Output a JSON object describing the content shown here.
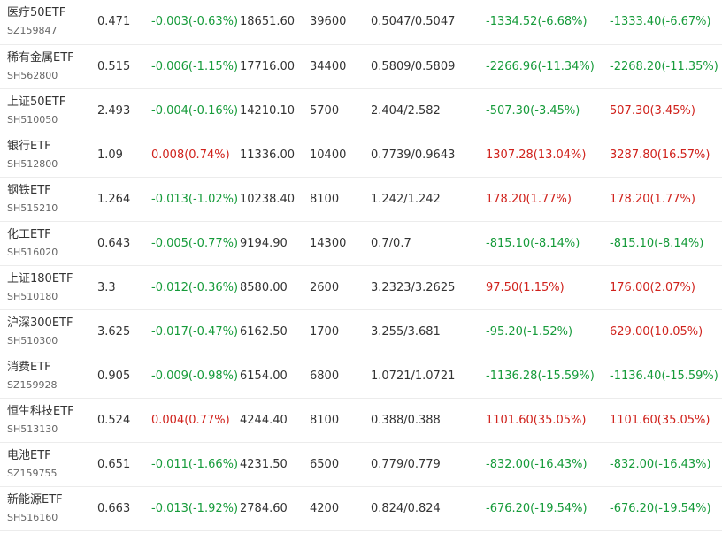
{
  "colors": {
    "up": "#d0221c",
    "down": "#169b3a",
    "text": "#333333",
    "code": "#666666"
  },
  "rows": [
    {
      "name": "医疗50ETF",
      "code": "SZ159847",
      "price": "0.471",
      "change": "-0.003(-0.63%)",
      "change_dir": "down",
      "amount": "18651.60",
      "shares": "39600",
      "cost": "0.5047/0.5047",
      "pl1": "-1334.52(-6.68%)",
      "pl1_dir": "down",
      "pl2": "-1333.40(-6.67%)",
      "pl2_dir": "down"
    },
    {
      "name": "稀有金属ETF",
      "code": "SH562800",
      "price": "0.515",
      "change": "-0.006(-1.15%)",
      "change_dir": "down",
      "amount": "17716.00",
      "shares": "34400",
      "cost": "0.5809/0.5809",
      "pl1": "-2266.96(-11.34%)",
      "pl1_dir": "down",
      "pl2": "-2268.20(-11.35%)",
      "pl2_dir": "down"
    },
    {
      "name": "上证50ETF",
      "code": "SH510050",
      "price": "2.493",
      "change": "-0.004(-0.16%)",
      "change_dir": "down",
      "amount": "14210.10",
      "shares": "5700",
      "cost": "2.404/2.582",
      "pl1": "-507.30(-3.45%)",
      "pl1_dir": "down",
      "pl2": "507.30(3.45%)",
      "pl2_dir": "up"
    },
    {
      "name": "银行ETF",
      "code": "SH512800",
      "price": "1.09",
      "change": "0.008(0.74%)",
      "change_dir": "up",
      "amount": "11336.00",
      "shares": "10400",
      "cost": "0.7739/0.9643",
      "pl1": "1307.28(13.04%)",
      "pl1_dir": "up",
      "pl2": "3287.80(16.57%)",
      "pl2_dir": "up"
    },
    {
      "name": "钢铁ETF",
      "code": "SH515210",
      "price": "1.264",
      "change": "-0.013(-1.02%)",
      "change_dir": "down",
      "amount": "10238.40",
      "shares": "8100",
      "cost": "1.242/1.242",
      "pl1": "178.20(1.77%)",
      "pl1_dir": "up",
      "pl2": "178.20(1.77%)",
      "pl2_dir": "up"
    },
    {
      "name": "化工ETF",
      "code": "SH516020",
      "price": "0.643",
      "change": "-0.005(-0.77%)",
      "change_dir": "down",
      "amount": "9194.90",
      "shares": "14300",
      "cost": "0.7/0.7",
      "pl1": "-815.10(-8.14%)",
      "pl1_dir": "down",
      "pl2": "-815.10(-8.14%)",
      "pl2_dir": "down"
    },
    {
      "name": "上证180ETF",
      "code": "SH510180",
      "price": "3.3",
      "change": "-0.012(-0.36%)",
      "change_dir": "down",
      "amount": "8580.00",
      "shares": "2600",
      "cost": "3.2323/3.2625",
      "pl1": "97.50(1.15%)",
      "pl1_dir": "up",
      "pl2": "176.00(2.07%)",
      "pl2_dir": "up"
    },
    {
      "name": "沪深300ETF",
      "code": "SH510300",
      "price": "3.625",
      "change": "-0.017(-0.47%)",
      "change_dir": "down",
      "amount": "6162.50",
      "shares": "1700",
      "cost": "3.255/3.681",
      "pl1": "-95.20(-1.52%)",
      "pl1_dir": "down",
      "pl2": "629.00(10.05%)",
      "pl2_dir": "up"
    },
    {
      "name": "消费ETF",
      "code": "SZ159928",
      "price": "0.905",
      "change": "-0.009(-0.98%)",
      "change_dir": "down",
      "amount": "6154.00",
      "shares": "6800",
      "cost": "1.0721/1.0721",
      "pl1": "-1136.28(-15.59%)",
      "pl1_dir": "down",
      "pl2": "-1136.40(-15.59%)",
      "pl2_dir": "down"
    },
    {
      "name": "恒生科技ETF",
      "code": "SH513130",
      "price": "0.524",
      "change": "0.004(0.77%)",
      "change_dir": "up",
      "amount": "4244.40",
      "shares": "8100",
      "cost": "0.388/0.388",
      "pl1": "1101.60(35.05%)",
      "pl1_dir": "up",
      "pl2": "1101.60(35.05%)",
      "pl2_dir": "up"
    },
    {
      "name": "电池ETF",
      "code": "SZ159755",
      "price": "0.651",
      "change": "-0.011(-1.66%)",
      "change_dir": "down",
      "amount": "4231.50",
      "shares": "6500",
      "cost": "0.779/0.779",
      "pl1": "-832.00(-16.43%)",
      "pl1_dir": "down",
      "pl2": "-832.00(-16.43%)",
      "pl2_dir": "down"
    },
    {
      "name": "新能源ETF",
      "code": "SH516160",
      "price": "0.663",
      "change": "-0.013(-1.92%)",
      "change_dir": "down",
      "amount": "2784.60",
      "shares": "4200",
      "cost": "0.824/0.824",
      "pl1": "-676.20(-19.54%)",
      "pl1_dir": "down",
      "pl2": "-676.20(-19.54%)",
      "pl2_dir": "down"
    }
  ]
}
